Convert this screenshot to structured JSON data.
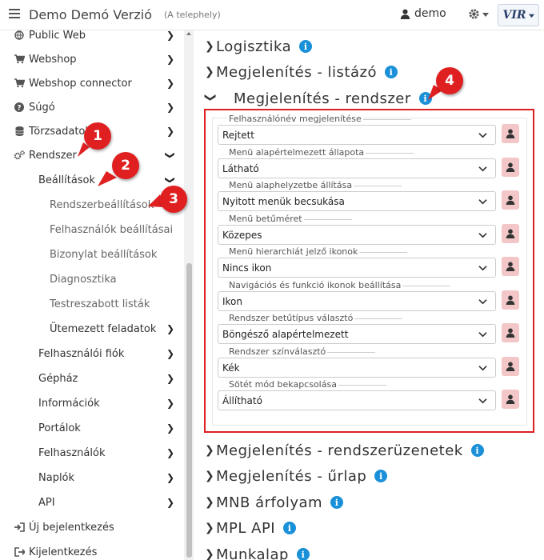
{
  "header": {
    "title": "Demo Demó Verzió",
    "subtitle": "(A telephely)",
    "user": "demo",
    "logo": "VIR"
  },
  "sidebar": {
    "items": [
      {
        "label": "Public Web",
        "icon": "globe-icon"
      },
      {
        "label": "Webshop",
        "icon": "cart-icon"
      },
      {
        "label": "Webshop connector",
        "icon": "cart-icon"
      },
      {
        "label": "Súgó",
        "icon": "question-circle-icon"
      },
      {
        "label": "Törzsadatok",
        "icon": "database-icon"
      },
      {
        "label": "Rendszer",
        "icon": "gears-icon"
      },
      {
        "label": "Beállítások"
      },
      {
        "label": "Rendszerbeállítások"
      },
      {
        "label": "Felhasználók beállításai"
      },
      {
        "label": "Bizonylat beállítások"
      },
      {
        "label": "Diagnosztika"
      },
      {
        "label": "Testreszabott listák"
      },
      {
        "label": "Ütemezett feladatok"
      },
      {
        "label": "Felhasználói fiók"
      },
      {
        "label": "Gépház"
      },
      {
        "label": "Információk"
      },
      {
        "label": "Portálok"
      },
      {
        "label": "Felhasználók"
      },
      {
        "label": "Naplók"
      },
      {
        "label": "API"
      },
      {
        "label": "Új bejelentkezés",
        "icon": "sign-in-icon"
      },
      {
        "label": "Kijelentkezés",
        "icon": "sign-out-icon"
      }
    ]
  },
  "markers": [
    "1",
    "2",
    "3",
    "4"
  ],
  "sections": {
    "above": [
      "Logisztika",
      "Megjelenítés - listázó"
    ],
    "open": "Megjelenítés - rendszer",
    "below": [
      "Megjelenítés - rendszerüzenetek",
      "Megjelenítés - űrlap",
      "MNB árfolyam",
      "MPL API",
      "Munkalap"
    ]
  },
  "settings": [
    {
      "label": "Felhasználónév megjelenítése",
      "value": "Rejtett"
    },
    {
      "label": "Menü alapértelmezett állapota",
      "value": "Látható"
    },
    {
      "label": "Menü alaphelyzetbe állítása",
      "value": "Nyitott menük becsukása"
    },
    {
      "label": "Menü betűméret",
      "value": "Közepes"
    },
    {
      "label": "Menü hierarchiát jelző ikonok",
      "value": "Nincs ikon"
    },
    {
      "label": "Navigációs és funkció ikonok beállítása",
      "value": "Ikon"
    },
    {
      "label": "Rendszer betűtípus választó",
      "value": "Böngésző alapértelmezett"
    },
    {
      "label": "Rendszer színválasztó",
      "value": "Kék"
    },
    {
      "label": "Sötét mód bekapcsolása",
      "value": "Állítható"
    }
  ],
  "colors": {
    "accent": "#1a90d8",
    "highlight": "#e02020",
    "chip": "#f3c7c7"
  }
}
